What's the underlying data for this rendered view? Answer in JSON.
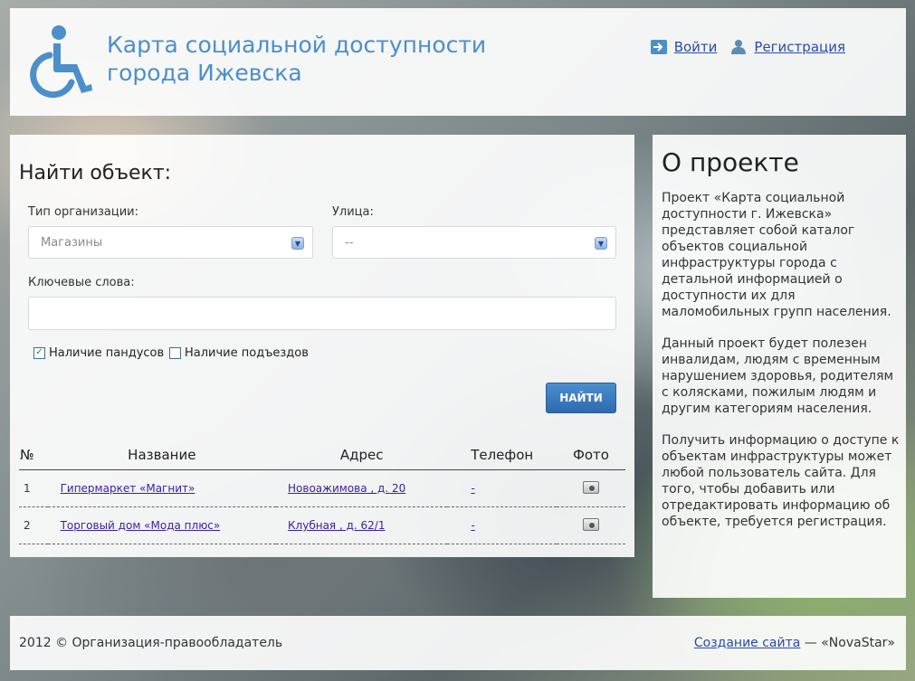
{
  "header": {
    "title_line1": "Карта социальной доступности",
    "title_line2": "города Ижевска",
    "login_label": "Войти",
    "register_label": "Регистрация",
    "logo_icon": "wheelchair-icon"
  },
  "search": {
    "title": "Найти объект:",
    "org_type_label": "Тип организации:",
    "org_type_value": "Магазины",
    "street_label": "Улица:",
    "street_value": "--",
    "keywords_label": "Ключевые слова:",
    "keywords_value": "",
    "ramps_label": "Наличие пандусов",
    "ramps_checked": true,
    "entrances_label": "Наличие подъездов",
    "entrances_checked": false,
    "submit_label": "НАЙТИ"
  },
  "results": {
    "columns": [
      "№",
      "Название",
      "Адрес",
      "Телефон",
      "Фото"
    ],
    "rows": [
      {
        "num": "1",
        "name": "Гипермаркет «Магнит»",
        "address": "Новоажимова , д. 20",
        "phone": "-"
      },
      {
        "num": "2",
        "name": "Торговый дом «Мода плюс»",
        "address": "Клубная , д. 62/1",
        "phone": "-"
      }
    ]
  },
  "about": {
    "title": "О проекте",
    "p1": "Проект «Карта социальной доступности г. Ижевска» представляет собой каталог объектов социальной инфраструктуры города с детальной информацией о доступности их для маломобильных групп населения.",
    "p2": "Данный проект будет полезен инвалидам, людям с временным нарушением здоровья, родителям с колясками, пожилым людям и другим категориям населения.",
    "p3": "Получить информацию о доступе к объектам инфраструктуры может любой пользователь сайта. Для того, чтобы добавить или отредактировать информацию об объекте, требуется регистрация."
  },
  "footer": {
    "copyright": "2012 © Организация-правообладатель",
    "credit_link": "Создание сайта",
    "credit_suffix": " — «NovaStar»"
  },
  "colors": {
    "accent": "#4b8fcb",
    "button": "#2e6aae",
    "link": "#2a4aa8"
  }
}
